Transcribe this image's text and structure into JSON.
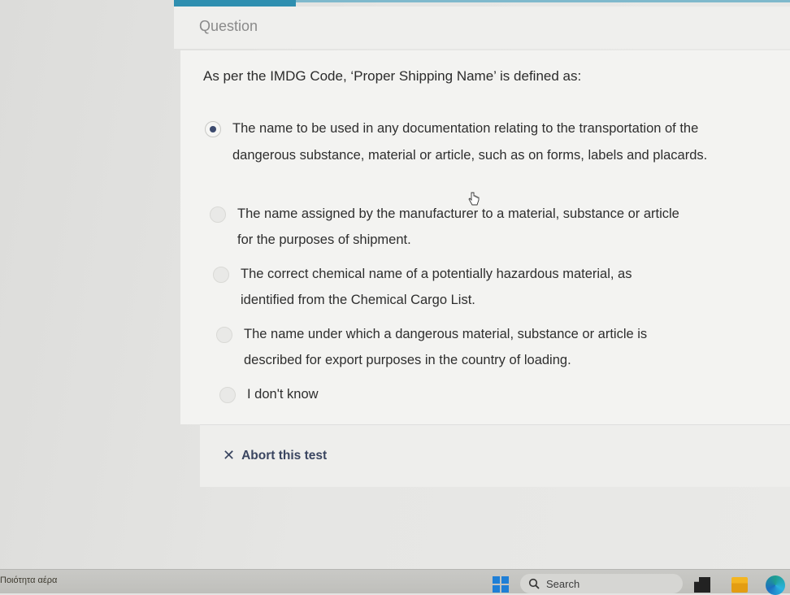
{
  "header": {
    "section_label": "Question"
  },
  "question": {
    "text": "As per the IMDG Code, ‘Proper Shipping Name’ is defined as:",
    "options": [
      {
        "label": "The name to be used in any documentation relating to the transportation of the dangerous substance, material or article, such as on forms, labels and placards.",
        "selected": true
      },
      {
        "label": "The name assigned by the manufacturer to a material, substance or article for the purposes of shipment.",
        "selected": false
      },
      {
        "label": "The correct chemical name of a potentially hazardous material, as identified from the Chemical Cargo List.",
        "selected": false
      },
      {
        "label": "The name under which a dangerous material, substance or article is described for export purposes in the country of loading.",
        "selected": false
      },
      {
        "label": "I don't know",
        "selected": false
      }
    ]
  },
  "footer": {
    "abort_label": "Abort this test"
  },
  "taskbar": {
    "weather_label": "Ποιότητα αέρα",
    "search_label": "Search"
  },
  "colors": {
    "accent": "#2f8fb0",
    "selected_dot": "#3c4a6e",
    "abort_text": "#3a4560"
  },
  "icons": {
    "abort": "close-icon",
    "search": "search-icon",
    "start": "windows-start-icon",
    "browser": "edge-icon",
    "folder": "file-explorer-icon"
  }
}
